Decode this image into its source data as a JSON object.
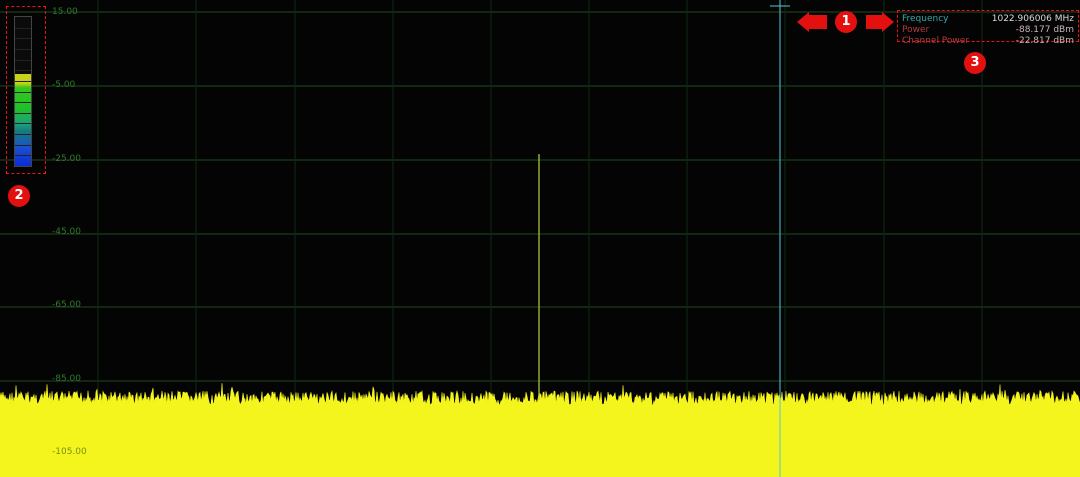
{
  "analyzer": {
    "y_axis": {
      "labels": [
        "15.00",
        "-5.00",
        "-25.00",
        "-45.00",
        "-65.00",
        "-85.00",
        "-105.00"
      ],
      "unit": "dBm"
    },
    "readout": {
      "frequency_label": "Frequency",
      "frequency_value": "1022.906006 MHz",
      "power_label": "Power",
      "power_value": "-88.177 dBm",
      "channel_power_label": "Channel Power",
      "channel_power_value": "-22.817 dBm"
    },
    "callouts": [
      "1",
      "2",
      "3"
    ],
    "level_meter": {
      "fill_fraction": 0.62
    },
    "colors": {
      "grid": "#1e4a1e",
      "trace": "#f5f51e",
      "marker_line": "#4fc7d6",
      "label_green": "#2f7a2a",
      "readout_cyan": "#3aa6a6",
      "callout_red": "#e31010"
    },
    "icons": [
      "level-meter-icon",
      "marker-crosshair-icon",
      "arrow-left-icon",
      "arrow-right-icon"
    ]
  }
}
